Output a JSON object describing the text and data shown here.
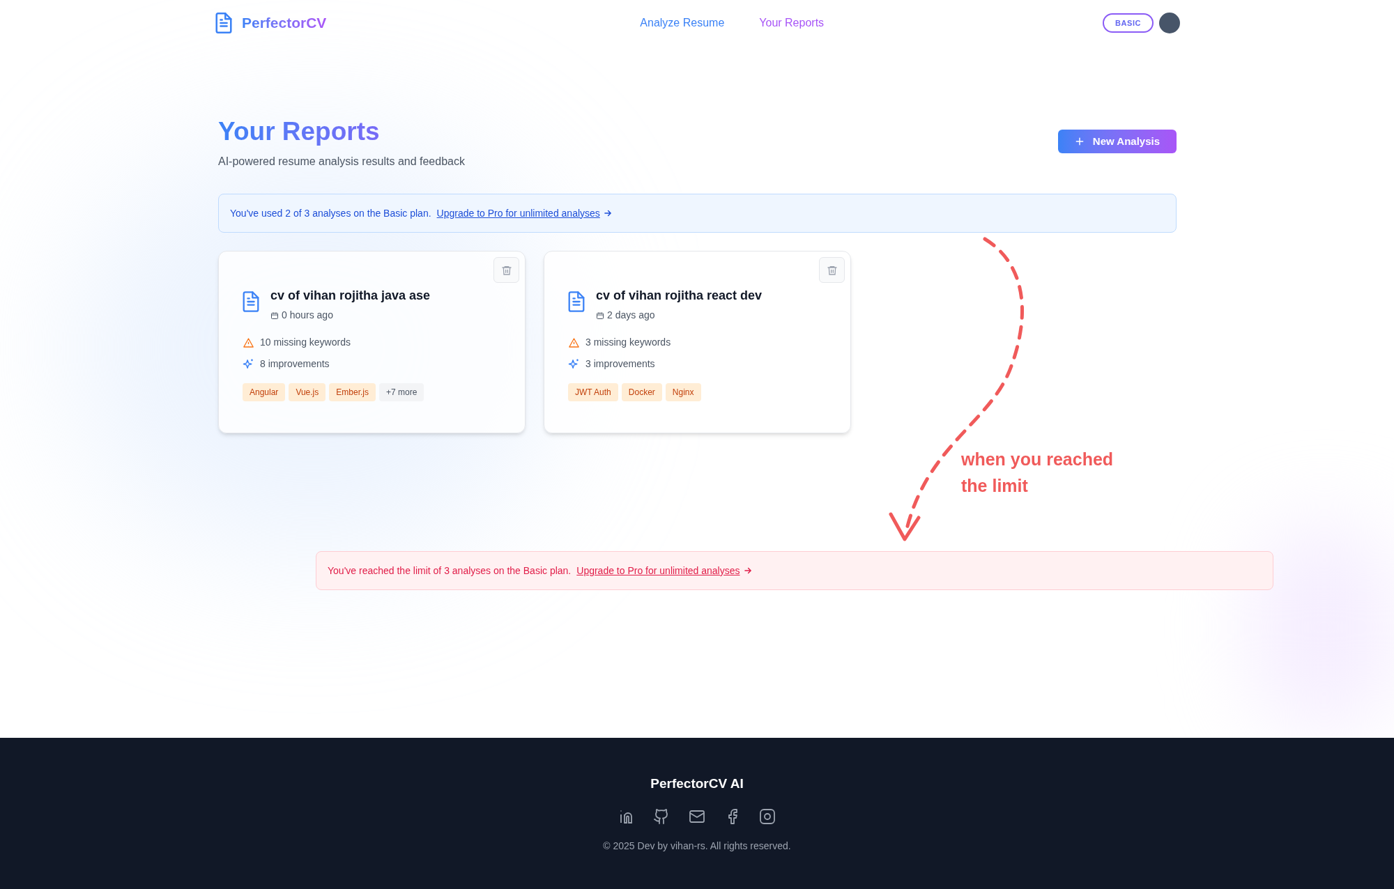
{
  "header": {
    "logo": "PerfectorCV",
    "nav": [
      {
        "label": "Analyze Resume",
        "selected": false
      },
      {
        "label": "Your Reports",
        "selected": true
      }
    ],
    "plan_badge": "BASIC"
  },
  "page": {
    "title": "Your Reports",
    "subtitle": "AI-powered resume analysis results and feedback",
    "new_button": "New Analysis"
  },
  "usage_notice": {
    "text": "You've used 2 of 3 analyses on the Basic plan.",
    "link": "Upgrade to Pro for unlimited analyses"
  },
  "reports": [
    {
      "title": "cv of vihan rojitha java ase",
      "date": "0 hours ago",
      "missing": "10 missing keywords",
      "improvements": "8 improvements",
      "tags": [
        {
          "label": "Angular",
          "kind": "keyword"
        },
        {
          "label": "Vue.js",
          "kind": "keyword"
        },
        {
          "label": "Ember.js",
          "kind": "keyword"
        },
        {
          "label": "+7 more",
          "kind": "more"
        }
      ]
    },
    {
      "title": "cv of vihan rojitha react dev",
      "date": "2 days ago",
      "missing": "3 missing keywords",
      "improvements": "3 improvements",
      "tags": [
        {
          "label": "JWT Auth",
          "kind": "keyword"
        },
        {
          "label": "Docker",
          "kind": "keyword"
        },
        {
          "label": "Nginx",
          "kind": "keyword"
        }
      ]
    }
  ],
  "annotation": "when you reached the limit",
  "limit_notice": {
    "text": "You've reached the limit of 3 analyses on the Basic plan.",
    "link": "Upgrade to Pro for unlimited analyses"
  },
  "footer": {
    "brand": "PerfectorCV AI",
    "copyright": "© 2025 Dev by vihan-rs. All rights reserved."
  }
}
